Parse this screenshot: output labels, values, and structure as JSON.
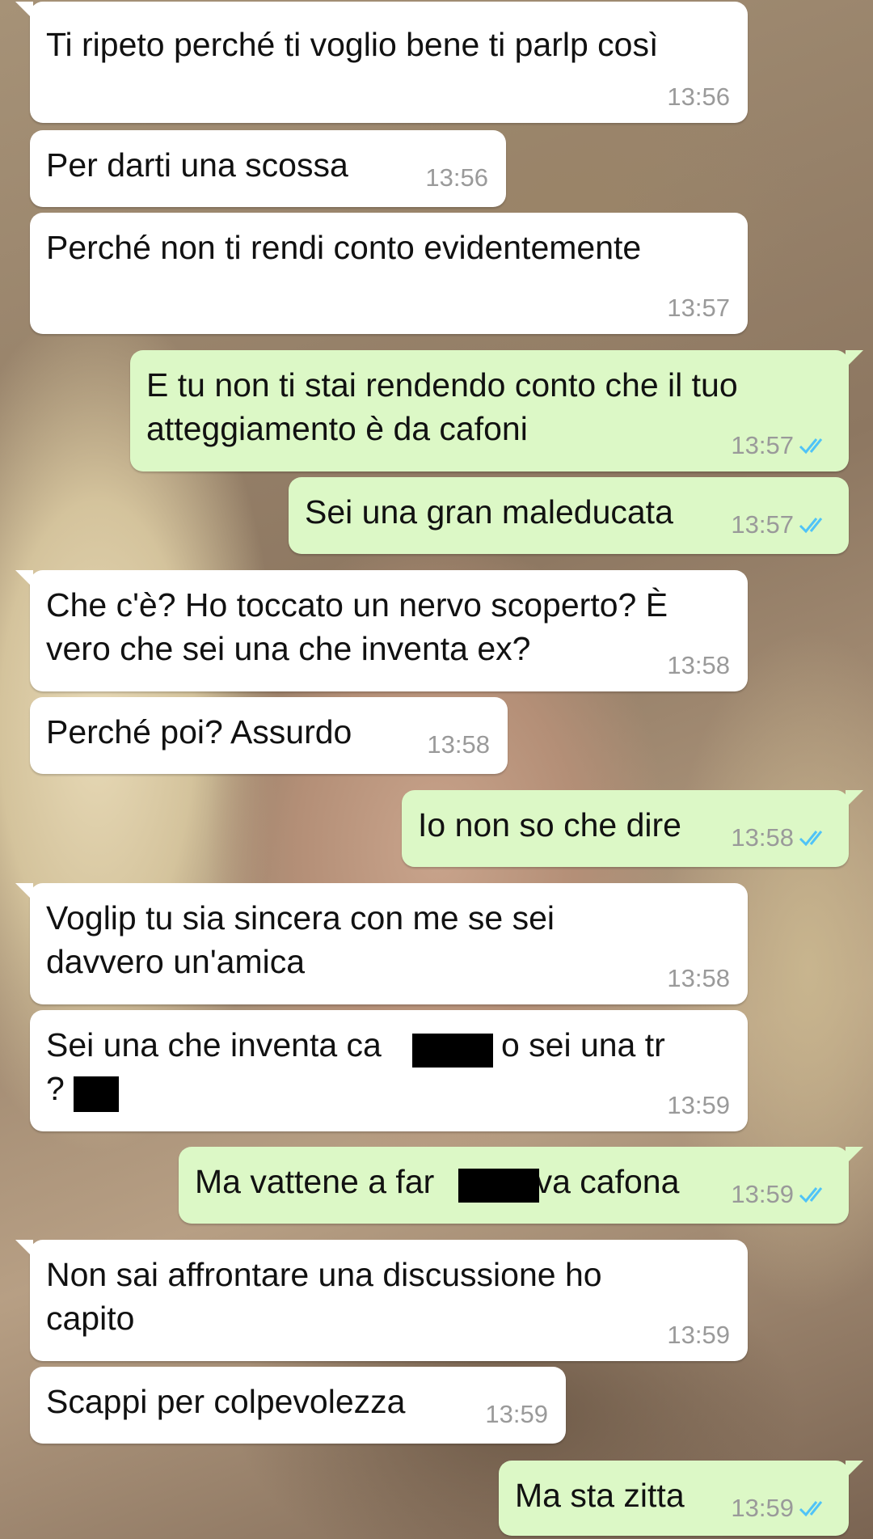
{
  "messages": [
    {
      "dir": "in",
      "text": "Ti ripeto perché ti voglio bene ti parlp così",
      "time": "13:56"
    },
    {
      "dir": "in",
      "text": "Per darti una scossa",
      "time": "13:56"
    },
    {
      "dir": "in",
      "text": "Perché non ti rendi conto evidentemente",
      "time": "13:57"
    },
    {
      "dir": "out",
      "text": "E tu non ti stai rendendo conto che il tuo atteggiamento è da cafoni",
      "time": "13:57",
      "read": true
    },
    {
      "dir": "out",
      "text": "Sei una gran maleducata",
      "time": "13:57",
      "read": true
    },
    {
      "dir": "in",
      "text": "Che c'è? Ho toccato un nervo scoperto? È vero che sei una che inventa ex?",
      "time": "13:58"
    },
    {
      "dir": "in",
      "text": "Perché poi? Assurdo",
      "time": "13:58"
    },
    {
      "dir": "out",
      "text": "Io non so che dire",
      "time": "13:58",
      "read": true
    },
    {
      "dir": "in",
      "text": "Voglip tu sia sincera con me se sei davvero un'amica",
      "time": "13:58"
    },
    {
      "dir": "in",
      "text": "Sei una che inventa ca          e o sei una tr     ?",
      "time": "13:59"
    },
    {
      "dir": "out",
      "text": "Ma vattene a far        o va cafona",
      "time": "13:59",
      "read": true
    },
    {
      "dir": "in",
      "text": "Non sai affrontare una discussione ho capito",
      "time": "13:59"
    },
    {
      "dir": "in",
      "text": "Scappi per colpevolezza",
      "time": "13:59"
    },
    {
      "dir": "out",
      "text": "Ma sta zitta",
      "time": "13:59",
      "read": true
    }
  ],
  "colors": {
    "incoming_bubble": "#ffffff",
    "outgoing_bubble": "#dcf8c6",
    "read_ticks": "#4fc3f7",
    "timestamp": "#9a9a9a"
  },
  "icons": {
    "read_receipt": "double-check-icon"
  }
}
